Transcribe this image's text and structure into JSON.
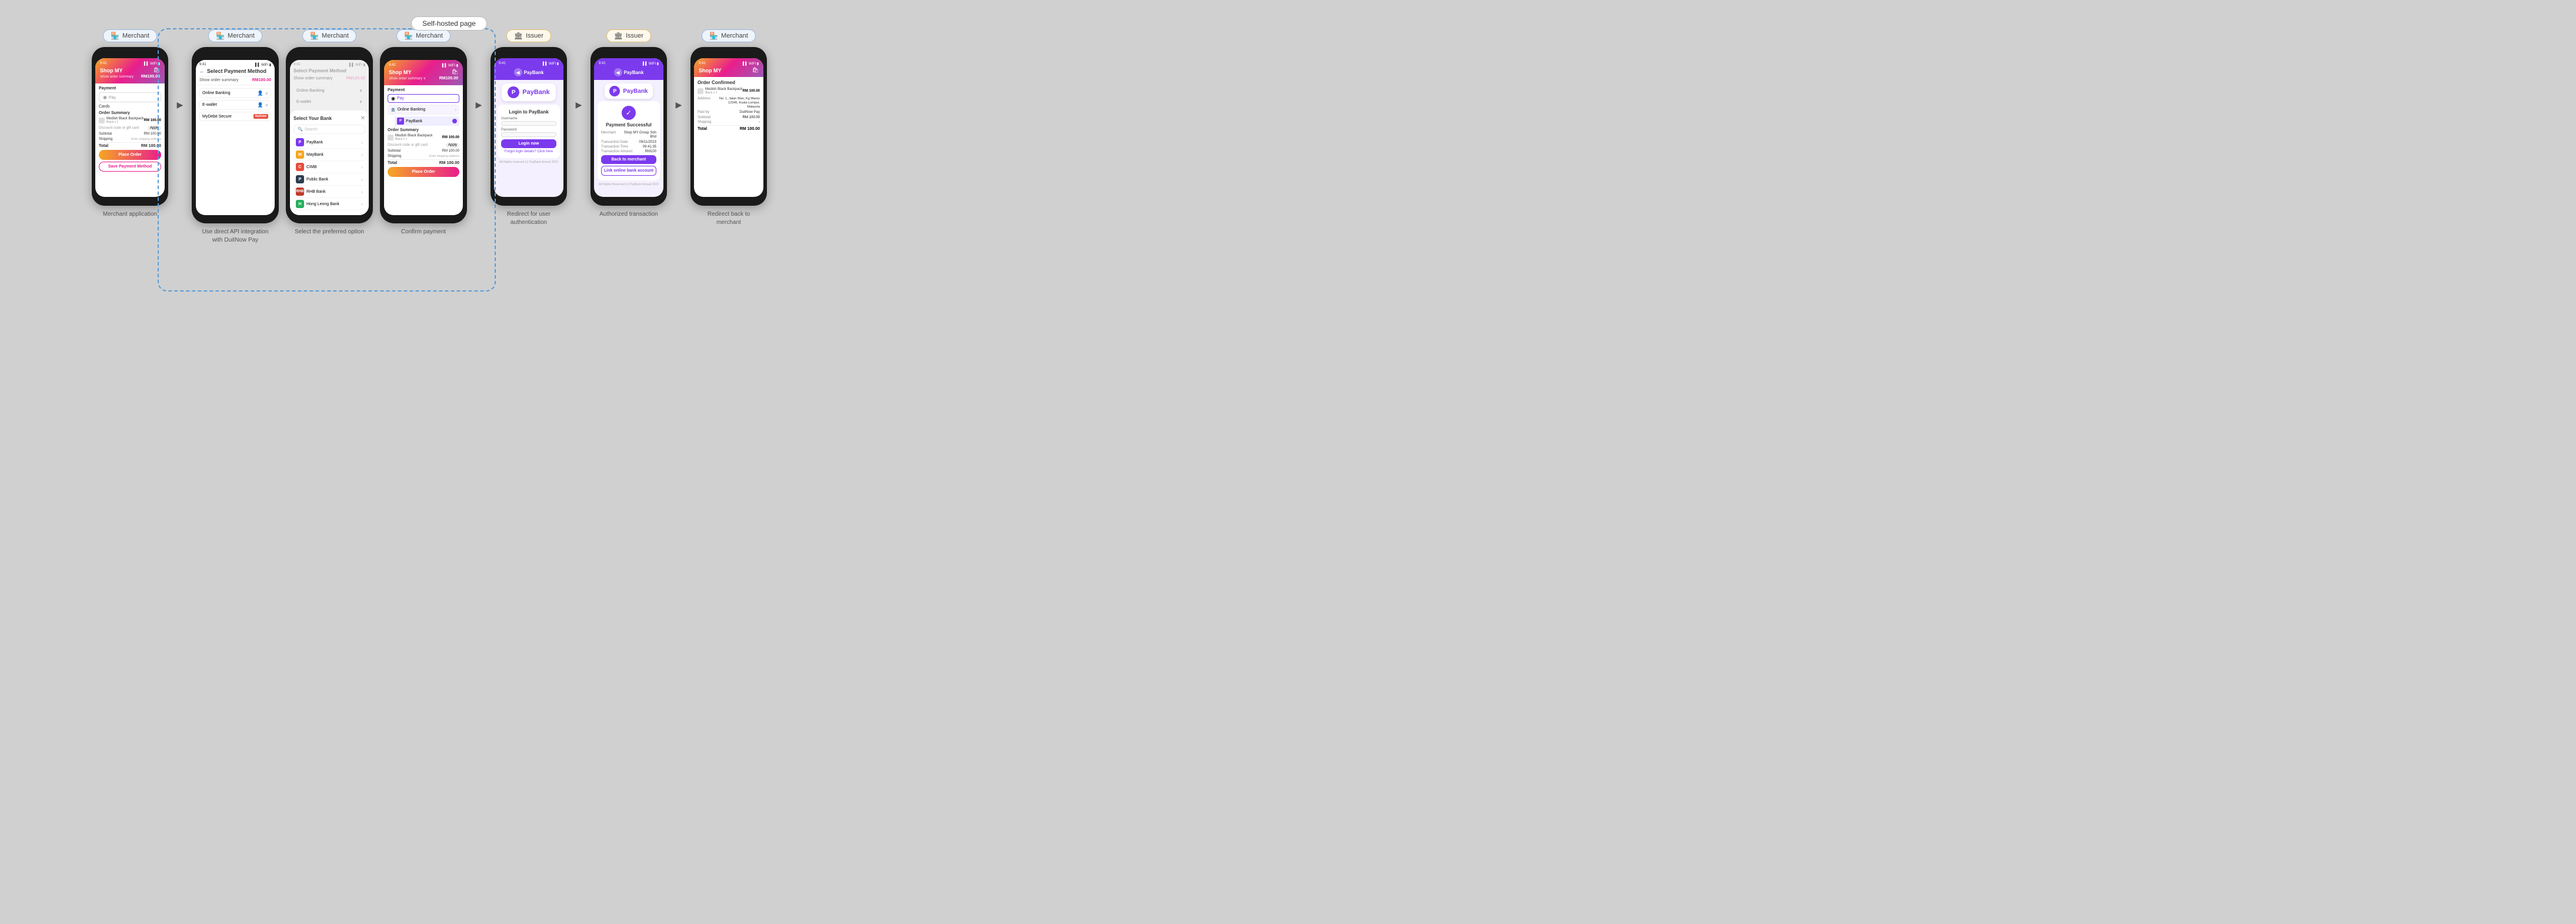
{
  "page": {
    "self_hosted_label": "Self-hosted page",
    "background_color": "#d0d0d0"
  },
  "badges": {
    "merchant": "Merchant",
    "issuer": "Issuer"
  },
  "phones": [
    {
      "id": "merchant-app",
      "badge": "merchant",
      "caption": "Merchant application",
      "screen": "merchant"
    },
    {
      "id": "select-payment-1",
      "badge": "merchant",
      "caption_line1": "Use direct API integration",
      "caption_line2": "with DuitNow Pay",
      "screen": "select-payment"
    },
    {
      "id": "select-preferred",
      "badge": "merchant",
      "caption": "Select the preferred option",
      "screen": "bank-popup"
    },
    {
      "id": "confirm-payment",
      "badge": "merchant",
      "caption": "Confirm payment",
      "screen": "confirm-payment"
    },
    {
      "id": "redirect-auth",
      "badge": "issuer",
      "caption_line1": "Redirect for user",
      "caption_line2": "authentication",
      "screen": "paybank-login"
    },
    {
      "id": "authorized-tx",
      "badge": "issuer",
      "caption": "Authorized transaction",
      "screen": "paybank-success"
    },
    {
      "id": "redirect-back",
      "badge": "merchant",
      "caption_line1": "Redirect back to",
      "caption_line2": "merchant",
      "screen": "order-confirmed"
    }
  ],
  "screens": {
    "merchant": {
      "shop_name": "Shop MY",
      "show_order": "Show order summary",
      "amount": "RM100.00",
      "payment_label": "Payment",
      "pay_placeholder": "Pay",
      "cards_label": "Cards",
      "order_summary": "Order Summary",
      "item_name": "Modish Black Backpack",
      "item_detail": "Black x 1",
      "item_price": "RM 100.00",
      "discount_placeholder": "Discount code or gift card",
      "apply": "Apply",
      "subtotal": "RM 100.00",
      "shipping": "Enter shipping address",
      "total": "RM 100.00",
      "place_order": "Place Order",
      "save_payment": "Save Payment Method"
    },
    "select_payment": {
      "title": "Select Payment Method",
      "show_order": "Show order summary",
      "amount": "RM100.00",
      "online_banking": "Online Banking",
      "ewallet": "E-wallet",
      "mydebit": "MyDebit Secure"
    },
    "bank_popup": {
      "title": "Select Your Bank",
      "search_placeholder": "Search",
      "banks": [
        "PayBank",
        "MayBank",
        "CIMB",
        "Public Bank",
        "RHB Bank",
        "Hong Leong Bank"
      ]
    },
    "confirm_payment": {
      "shop_name": "Shop MY",
      "amount": "RM100.00",
      "payment_label": "Payment",
      "pay_value": "Pay",
      "online_banking": "Online Banking",
      "paybank": "PayBank",
      "order_summary": "Order Summary",
      "item_name": "Modish Black Backpack",
      "item_detail": "Black x 1",
      "item_price": "RM 100.00",
      "discount_placeholder": "Discount code or gift card",
      "apply": "Apply",
      "subtotal": "RM 100.00",
      "shipping": "Enter shipping address",
      "total": "RM 100.00",
      "place_order": "Place Order"
    },
    "paybank_login": {
      "app_name": "PayBank",
      "title": "Login to PayBank",
      "username_label": "Username",
      "password_label": "Password",
      "login_btn": "Login now",
      "forgot_text": "Forgot login details? Click here",
      "footer": "All Rights reserved (c) PayBank Annual 2023"
    },
    "paybank_success": {
      "app_name": "PayBank",
      "title": "Payment Successful",
      "merchant_label": "Merchant",
      "merchant_value": "Shop MY Group Sdn Bhd",
      "tx_date_label": "Transaction Date",
      "tx_date_value": "09/11/2023",
      "tx_time_label": "Transaction Time",
      "tx_time_value": "09:41:35",
      "tx_amount_label": "Transaction Amount",
      "tx_amount_value": "RM100",
      "back_to_merchant": "Back to merchant",
      "link_account": "Link online bank account",
      "footer": "All Rights Reserved (c) PayBank Annual 2023"
    },
    "order_confirmed": {
      "shop_name": "Shop MY",
      "title": "Order Confirmed",
      "item_name": "Modish Black Backpack",
      "item_detail": "Black x 1",
      "item_price": "RM 100.00",
      "address_label": "Address",
      "address_value": "No. 1, Jalan Wan, Kg Wantu 12345, Kuala Lumpur, Malaysia",
      "paid_by_label": "Paid by",
      "paid_by_value": "DuitNow Pay",
      "subtotal_label": "Subtotal",
      "subtotal_value": "RM 100.00",
      "shipping_label": "Shipping",
      "shipping_value": "-",
      "total_label": "Total",
      "total_value": "RM 100.00"
    }
  }
}
